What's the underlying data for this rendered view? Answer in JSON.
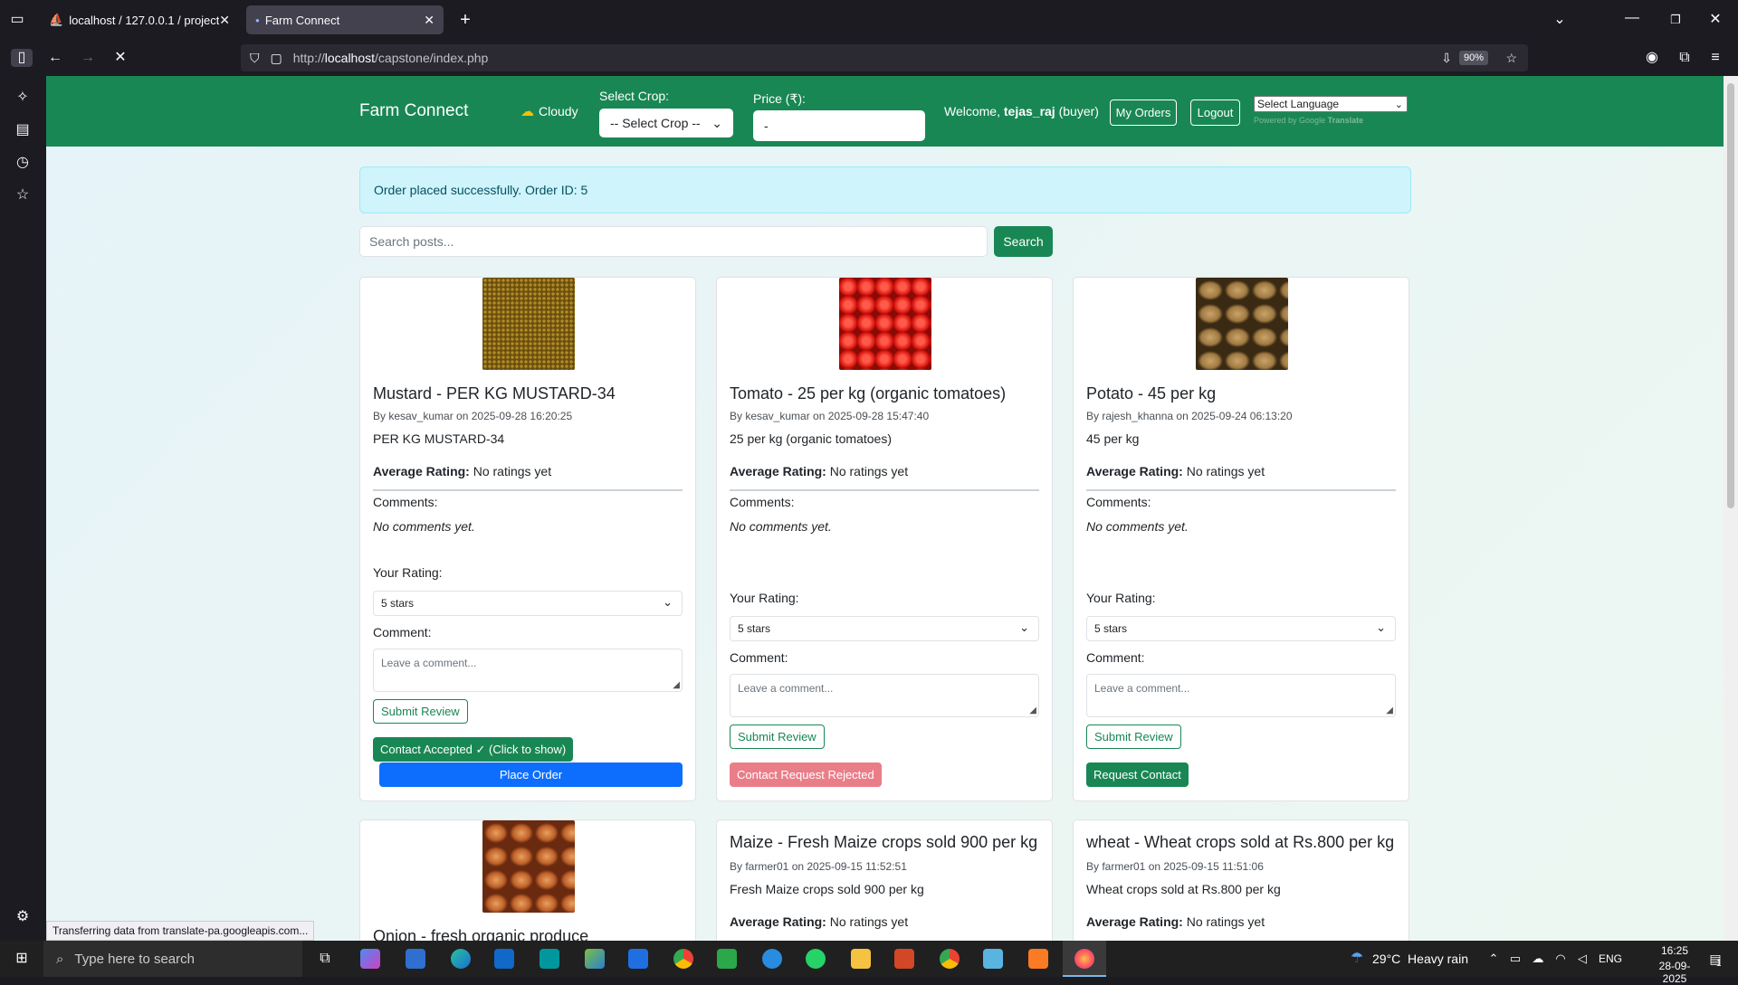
{
  "browser": {
    "tabs": [
      {
        "label": "localhost / 127.0.0.1 / project / ...",
        "active": false
      },
      {
        "label": "Farm Connect",
        "active": true
      }
    ],
    "url_prefix": "http://",
    "url_host": "localhost",
    "url_path": "/capstone/index.php",
    "zoom": "90%",
    "status_text": "Transferring data from translate-pa.googleapis.com..."
  },
  "header": {
    "brand": "Farm Connect",
    "weather": "Cloudy",
    "select_crop_label": "Select Crop:",
    "select_crop_value": "-- Select Crop --",
    "price_label": "Price (₹):",
    "price_value": "-",
    "welcome_prefix": "Welcome,",
    "username": "tejas_raj",
    "role": "(buyer)",
    "my_orders": "My Orders",
    "logout": "Logout",
    "language": "Select Language",
    "powered_by": "Powered by",
    "google": "Google",
    "translate": "Translate"
  },
  "alert": "Order placed successfully. Order ID: 5",
  "search": {
    "placeholder": "Search posts...",
    "button": "Search"
  },
  "posts": [
    {
      "title": "Mustard - PER KG MUSTARD-34",
      "meta": "By kesav_kumar on 2025-09-28 16:20:25",
      "body": "PER KG MUSTARD-34",
      "rating_label": "Average Rating:",
      "rating_value": "No ratings yet",
      "comments_label": "Comments:",
      "no_comments": "No comments yet.",
      "your_rating": "Your Rating:",
      "rating_select": "5 stars",
      "comment_label": "Comment:",
      "comment_placeholder": "Leave a comment...",
      "submit": "Submit Review",
      "contact": "Contact Accepted ✓ (Click to show)",
      "order": "Place Order"
    },
    {
      "title": "Tomato - 25 per kg (organic tomatoes)",
      "meta": "By kesav_kumar on 2025-09-28 15:47:40",
      "body": "25 per kg (organic tomatoes)",
      "rating_label": "Average Rating:",
      "rating_value": "No ratings yet",
      "comments_label": "Comments:",
      "no_comments": "No comments yet.",
      "your_rating": "Your Rating:",
      "rating_select": "5 stars",
      "comment_label": "Comment:",
      "comment_placeholder": "Leave a comment...",
      "submit": "Submit Review",
      "contact": "Contact Request Rejected"
    },
    {
      "title": "Potato - 45 per kg",
      "meta": "By rajesh_khanna on 2025-09-24 06:13:20",
      "body": "45 per kg",
      "rating_label": "Average Rating:",
      "rating_value": "No ratings yet",
      "comments_label": "Comments:",
      "no_comments": "No comments yet.",
      "your_rating": "Your Rating:",
      "rating_select": "5 stars",
      "comment_label": "Comment:",
      "comment_placeholder": "Leave a comment...",
      "submit": "Submit Review",
      "contact": "Request Contact"
    },
    {
      "title": "Onion - fresh organic produce"
    },
    {
      "title": "Maize - Fresh Maize crops sold 900 per kg",
      "meta": "By farmer01 on 2025-09-15 11:52:51",
      "body": "Fresh Maize crops sold 900 per kg",
      "rating_label": "Average Rating:",
      "rating_value": "No ratings yet"
    },
    {
      "title": "wheat - Wheat crops sold at Rs.800 per kg",
      "meta": "By farmer01 on 2025-09-15 11:51:06",
      "body": "Wheat crops sold at Rs.800 per kg",
      "rating_label": "Average Rating:",
      "rating_value": "No ratings yet"
    }
  ],
  "taskbar": {
    "search_placeholder": "Type here to search",
    "weather": "29°C  Heavy rain",
    "lang": "ENG",
    "time": "16:25",
    "date": "28-09-2025",
    "notif_count": "1"
  },
  "colors": {
    "primary_green": "#198754",
    "blue": "#0d6efd",
    "danger_light": "#e97e89",
    "alert_bg": "#cff4fc"
  }
}
